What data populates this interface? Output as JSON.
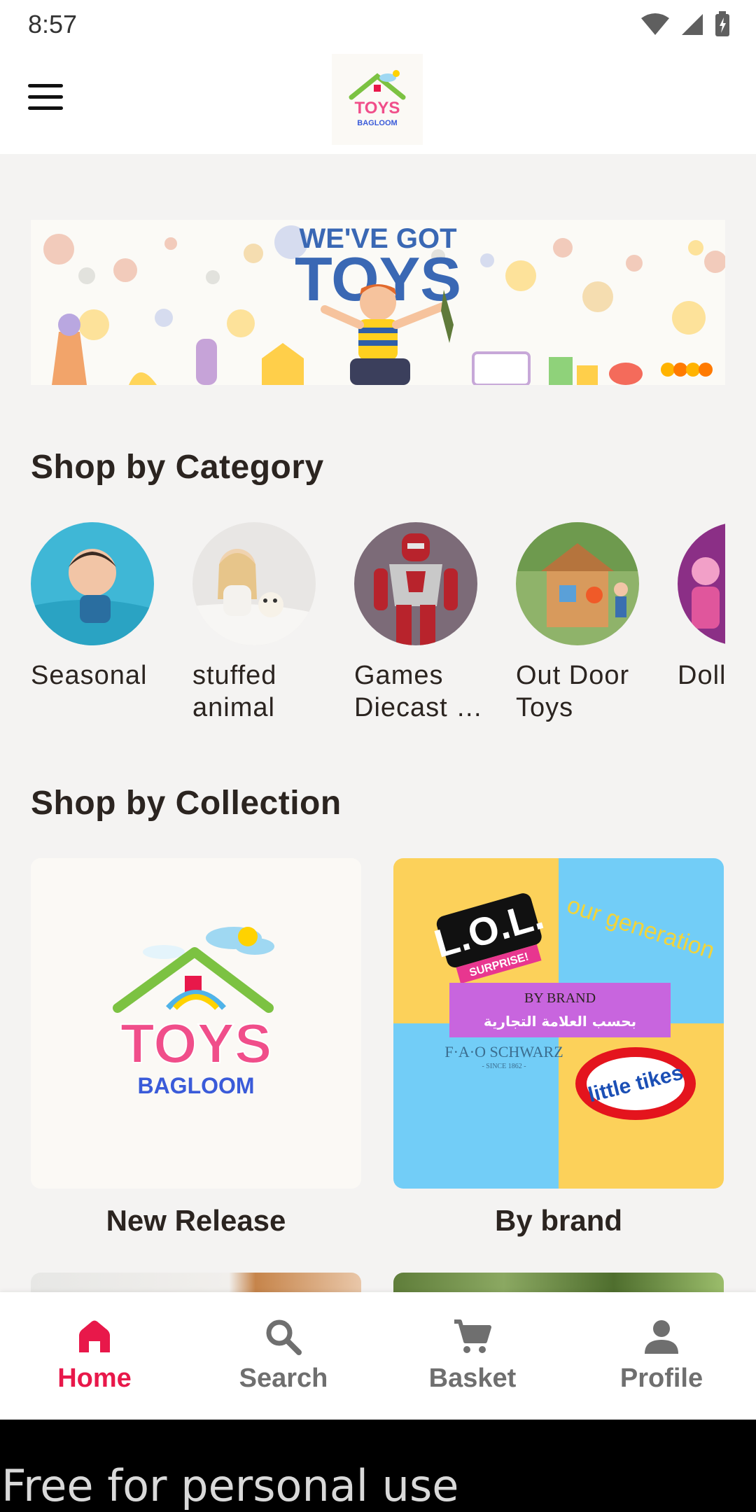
{
  "status_bar": {
    "time": "8:57"
  },
  "header": {
    "logo_title": "TOYS",
    "logo_subtitle": "BAGLOOM"
  },
  "banner": {
    "line1": "WE'VE GOT",
    "line2": "TOYS"
  },
  "categories_section": {
    "title": "Shop by Category",
    "items": [
      {
        "label_line1": "Seasonal",
        "label_line2": ""
      },
      {
        "label_line1": "stuffed",
        "label_line2": "animal"
      },
      {
        "label_line1": "Games",
        "label_line2": "Diecast …"
      },
      {
        "label_line1": "Out Door",
        "label_line2": "Toys"
      },
      {
        "label_line1": "Doll",
        "label_line2": ""
      }
    ]
  },
  "collections_section": {
    "title": "Shop by Collection",
    "items": [
      {
        "label": "New Release",
        "logo_title": "TOYS",
        "logo_subtitle": "BAGLOOM"
      },
      {
        "label": "By brand",
        "badge_en": "BY BRAND",
        "badge_ar": "بحسب العلامة التجارية",
        "brand_lol": "L.O.L.",
        "brand_lol_sub": "SURPRISE!",
        "brand_og": "our generation",
        "brand_fao": "F·A·O SCHWARZ",
        "brand_fao_sub": "- SINCE 1862 -",
        "brand_lt": "little tikes"
      }
    ]
  },
  "bottom_nav": {
    "items": [
      {
        "label": "Home",
        "icon": "home-icon",
        "active": true
      },
      {
        "label": "Search",
        "icon": "search-icon",
        "active": false
      },
      {
        "label": "Basket",
        "icon": "cart-icon",
        "active": false
      },
      {
        "label": "Profile",
        "icon": "profile-icon",
        "active": false
      }
    ]
  },
  "footer": {
    "text": "Free for personal use"
  },
  "colors": {
    "accent": "#e8184a",
    "inactive": "#6f6f6f",
    "text": "#2b2420",
    "background": "#f4f3f2"
  }
}
